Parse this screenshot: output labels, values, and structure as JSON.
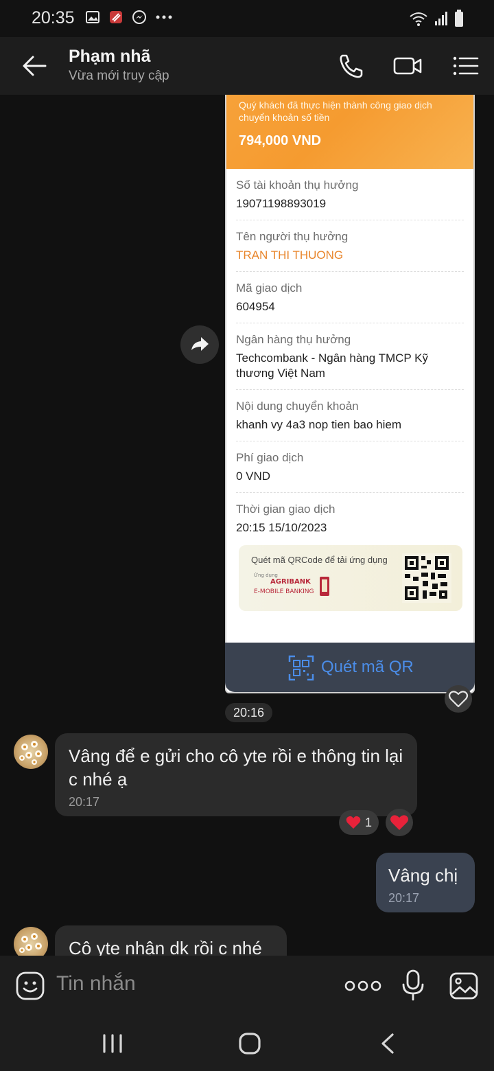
{
  "status_bar": {
    "time": "20:35",
    "icons": [
      "gallery-icon",
      "app-icon",
      "messenger-icon",
      "more-dots-icon"
    ],
    "right_icons": [
      "wifi-icon",
      "signal-icon",
      "battery-icon"
    ]
  },
  "header": {
    "contact_name": "Phạm nhã",
    "status": "Vừa mới truy cập",
    "actions": [
      "phone-icon",
      "video-icon",
      "menu-icon"
    ]
  },
  "receipt": {
    "message": "Quý khách đã thực hiện thành công giao dịch chuyển khoản số tiền",
    "amount": "794,000 VND",
    "rows": [
      {
        "label": "Số tài khoản thụ hưởng",
        "value": "19071198893019"
      },
      {
        "label": "Tên người thụ hưởng",
        "value": "TRAN THI THUONG"
      },
      {
        "label": "Mã giao dịch",
        "value": "604954"
      },
      {
        "label": "Ngân hàng thụ hưởng",
        "value": "Techcombank - Ngân hàng TMCP Kỹ thương Việt Nam"
      },
      {
        "label": "Nội dung chuyển khoản",
        "value": "khanh vy 4a3 nop tien bao hiem"
      },
      {
        "label": "Phí giao dịch",
        "value": "0 VND"
      },
      {
        "label": "Thời gian giao dịch",
        "value": "20:15 15/10/2023"
      }
    ],
    "qr_banner_text": "Quét mã QRCode để tải ứng dụng",
    "agribank_small": "Ứng dụng",
    "agribank_brand": "AGRIBANK",
    "agribank_product": "E-MOBILE BANKING",
    "scan_qr_label": "Quét mã QR"
  },
  "receipt_time": "20:16",
  "messages": [
    {
      "direction": "in",
      "text": "Vâng để e gửi cho cô yte rồi e thông tin lại c nhé ạ",
      "time": "20:17",
      "reaction_count": "1"
    },
    {
      "direction": "out",
      "text": "Vâng chị",
      "time": "20:17"
    },
    {
      "direction": "in",
      "text": "Cô yte nhận dk rồi c nhé",
      "time": ""
    }
  ],
  "composer": {
    "placeholder": "Tin nhắn",
    "icons": [
      "emoji-icon",
      "more-icon",
      "mic-icon",
      "image-icon"
    ]
  },
  "nav": [
    "recent-apps-icon",
    "home-icon",
    "back-nav-icon"
  ],
  "colors": {
    "background": "#111111",
    "header": "#1d1d1d",
    "incoming_bubble": "#2b2b2b",
    "outgoing_bubble": "#3a4250",
    "receipt_accent": "#f7a23a",
    "link_blue": "#4b8de8",
    "heart": "#e8223a"
  }
}
